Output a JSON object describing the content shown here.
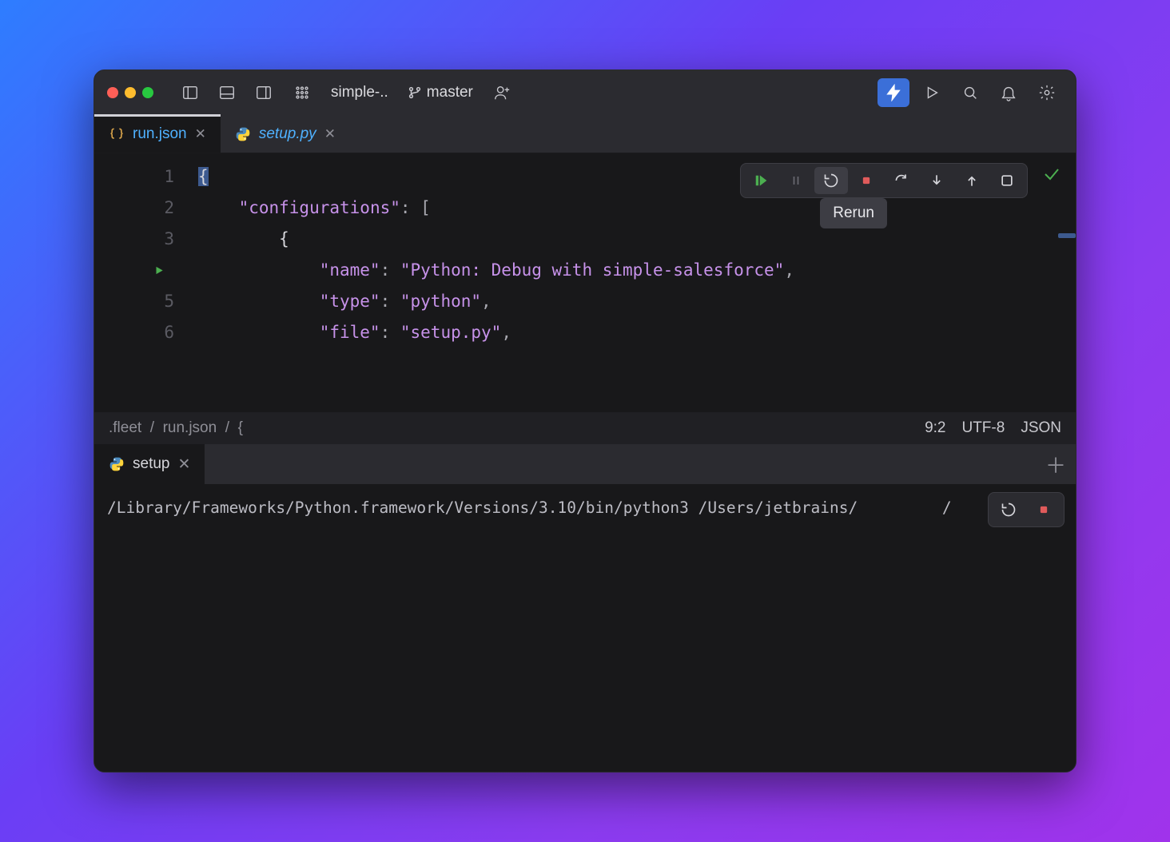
{
  "titlebar": {
    "project_name": "simple-..",
    "branch_name": "master"
  },
  "tabs": [
    {
      "label": "run.json",
      "icon": "json",
      "active": true,
      "italic": false
    },
    {
      "label": "setup.py",
      "icon": "python",
      "active": false,
      "italic": true
    }
  ],
  "editor": {
    "lines": [
      {
        "n": "1",
        "html": "<span class='cursor-hl tok-brace'>{</span>"
      },
      {
        "n": "2",
        "html": "    <span class='tok-key'>\"configurations\"</span><span class='tok-punc'>: [</span>"
      },
      {
        "n": "3",
        "html": "        <span class='tok-brace'>{</span>"
      },
      {
        "n": "",
        "html": "            <span class='tok-key'>\"name\"</span><span class='tok-punc'>: </span><span class='tok-str'>\"Python: Debug with simple-salesforce\"</span><span class='tok-punc'>,</span>",
        "run_glyph": true
      },
      {
        "n": "5",
        "html": "            <span class='tok-key'>\"type\"</span><span class='tok-punc'>: </span><span class='tok-str'>\"python\"</span><span class='tok-punc'>,</span>"
      },
      {
        "n": "6",
        "html": "            <span class='tok-key'>\"file\"</span><span class='tok-punc'>: </span><span class='tok-str'>\"setup.py\"</span><span class='tok-punc'>,</span>"
      }
    ],
    "tooltip": "Rerun"
  },
  "statusbar": {
    "crumb": ".fleet  /  run.json  /  {",
    "cursor": "9:2",
    "encoding": "UTF-8",
    "lang": "JSON"
  },
  "panel": {
    "tab_label": "setup",
    "terminal_text": "/Library/Frameworks/Python.framework/Versions/3.10/bin/python3 /Users/jetbrains/         /"
  }
}
